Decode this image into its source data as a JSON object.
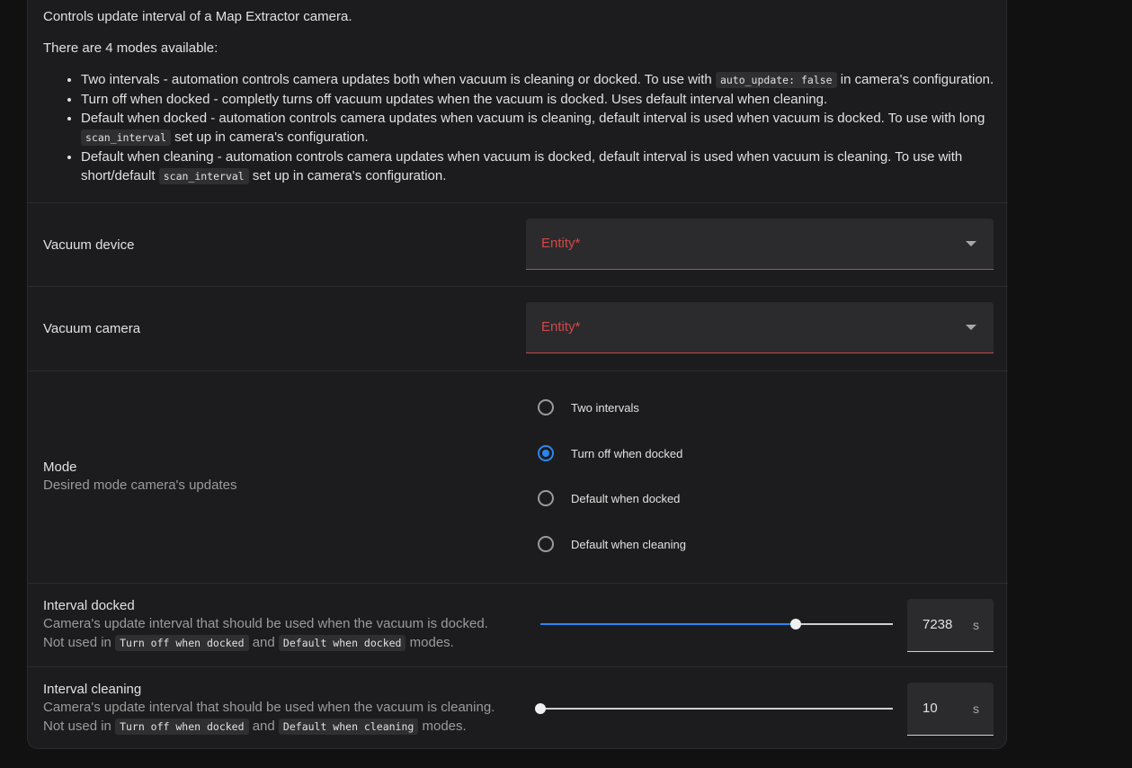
{
  "description": {
    "line1": "Controls update interval of a Map Extractor camera.",
    "line2": "There are 4 modes available:",
    "modes": [
      {
        "pre": "Two intervals - automation controls camera updates both when vacuum is cleaning or docked. To use with ",
        "code": "auto_update: false",
        "post": " in camera's configuration."
      },
      {
        "pre": "Turn off when docked - completly turns off vacuum updates when the vacuum is docked. Uses default interval when cleaning.",
        "code": "",
        "post": ""
      },
      {
        "pre": "Default when docked - automation controls camera updates when vacuum is cleaning, default interval is used when vacuum is docked. To use with long ",
        "code": "scan_interval",
        "post": " set up in camera's configuration."
      },
      {
        "pre": "Default when cleaning - automation controls camera updates when vacuum is docked, default interval is used when vacuum is cleaning. To use with short/default ",
        "code": "scan_interval",
        "post": " set up in camera's configuration."
      }
    ]
  },
  "vacuum_device": {
    "label": "Vacuum device",
    "placeholder": "Entity*"
  },
  "vacuum_camera": {
    "label": "Vacuum camera",
    "placeholder": "Entity*"
  },
  "mode": {
    "label": "Mode",
    "sub": "Desired mode camera's updates",
    "options": [
      "Two intervals",
      "Turn off when docked",
      "Default when docked",
      "Default when cleaning"
    ],
    "selected": "Turn off when docked"
  },
  "interval_docked": {
    "label": "Interval docked",
    "sub1": "Camera's update interval that should be used when the vacuum is docked.",
    "not_used": "Not used in",
    "code1": "Turn off when docked",
    "and": "and",
    "code2": "Default when docked",
    "modes": "modes.",
    "value": "7238",
    "unit": "s",
    "fraction": 0.724
  },
  "interval_cleaning": {
    "label": "Interval cleaning",
    "sub1": "Camera's update interval that should be used when the vacuum is cleaning.",
    "not_used": "Not used in",
    "code1": "Turn off when docked",
    "and": "and",
    "code2": "Default when cleaning",
    "modes": "modes.",
    "value": "10",
    "unit": "s",
    "fraction": 0.0
  },
  "colors": {
    "accent": "#2d86f0",
    "error": "#d14848",
    "background": "#1c1c1e"
  },
  "icons": {
    "dropdown": "chevron-down-icon"
  }
}
